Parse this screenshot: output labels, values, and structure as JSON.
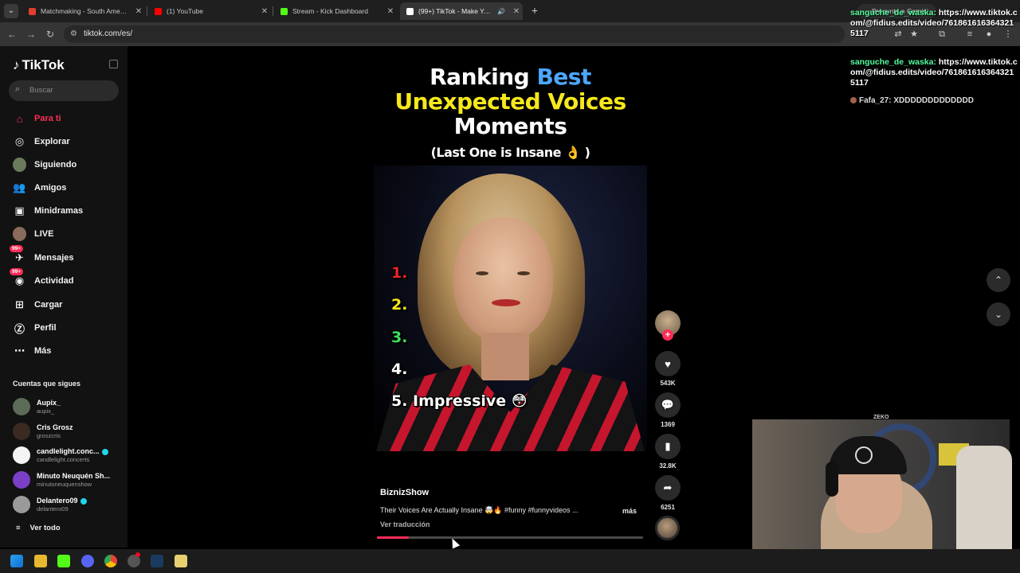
{
  "browser": {
    "tabs": [
      {
        "title": "Matchmaking - South America",
        "favicon_color": "#e0402a"
      },
      {
        "title": "(1) YouTube",
        "favicon_color": "#ff0000"
      },
      {
        "title": "Stream - Kick Dashboard",
        "favicon_color": "#53fc18"
      },
      {
        "title": "(99+) TikTok - Make Your Day",
        "favicon_color": "#ffffff",
        "active": true
      }
    ],
    "gemini_label": "Pregunta a Gemini",
    "url": "tiktok.com/es/"
  },
  "sidebar": {
    "brand": "TikTok",
    "search_placeholder": "Buscar",
    "nav": [
      {
        "label": "Para ti",
        "icon": "home-icon",
        "active": true
      },
      {
        "label": "Explorar",
        "icon": "compass-icon"
      },
      {
        "label": "Siguiendo",
        "icon": "following-avatar-icon"
      },
      {
        "label": "Amigos",
        "icon": "friends-icon"
      },
      {
        "label": "Minidramas",
        "icon": "film-icon"
      },
      {
        "label": "LIVE",
        "icon": "live-avatar-icon"
      },
      {
        "label": "Mensajes",
        "icon": "messages-icon",
        "badge": "99+"
      },
      {
        "label": "Actividad",
        "icon": "activity-icon",
        "badge": "99+"
      },
      {
        "label": "Cargar",
        "icon": "upload-icon"
      },
      {
        "label": "Perfil",
        "icon": "profile-icon"
      },
      {
        "label": "Más",
        "icon": "more-icon"
      }
    ],
    "following_title": "Cuentas que sigues",
    "following": [
      {
        "name": "Aupix_",
        "handle": "aupix_",
        "verified": false
      },
      {
        "name": "Cris Grosz",
        "handle": "groszcris",
        "verified": false
      },
      {
        "name": "candlelight.conc...",
        "handle": "candlelight.concerts",
        "verified": true
      },
      {
        "name": "Minuto Neuquén Sh...",
        "handle": "minutoneuquenshow",
        "verified": false
      },
      {
        "name": "Delantero09",
        "handle": "delantero09",
        "verified": true
      }
    ],
    "see_all": "Ver todo"
  },
  "video": {
    "overlay_title": {
      "ranking": "Ranking",
      "best": "Best",
      "line2": "Unexpected Voices",
      "line3": "Moments",
      "subtitle": "(Last One is Insane 👌 )"
    },
    "rank_items": [
      "1.",
      "2.",
      "3.",
      "4.",
      "5. Impressive 😳"
    ],
    "rank_colors": [
      "#e8242a",
      "#f6e81c",
      "#3ee05c",
      "#ffffff",
      "#ffffff"
    ],
    "author": "BiznizShow",
    "description": "Their Voices Are Actually Insane 🤯🔥 #funny #funnyvideos ...",
    "more_label": "más",
    "translate_label": "Ver traducción",
    "progress": 0.12
  },
  "actions": {
    "likes": "543K",
    "comments": "1369",
    "saves": "32.8K",
    "shares": "6251"
  },
  "chat": [
    {
      "user": "sanguche_de_waska:",
      "text": "https://www.tiktok.com/@fidius.edits/video/7618616163643215117"
    },
    {
      "user": "sanguche_de_waska:",
      "text": "https://www.tiktok.com/@fidius.edits/video/7618616163643215117"
    },
    {
      "user": "Fafa_27:",
      "text": "XDDDDDDDDDDDDD"
    }
  ],
  "webcam": {
    "label": "ZEKO"
  }
}
